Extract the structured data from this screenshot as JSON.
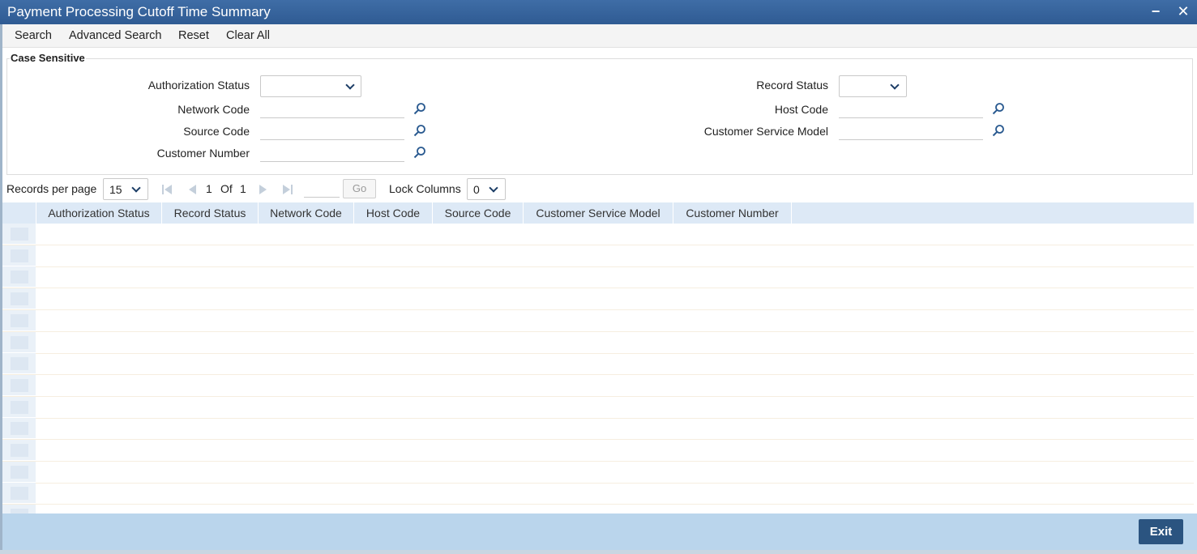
{
  "window": {
    "title": "Payment Processing Cutoff Time Summary",
    "minimize": "−",
    "close": "✕"
  },
  "toolbar": {
    "search": "Search",
    "advanced_search": "Advanced Search",
    "reset": "Reset",
    "clear_all": "Clear All"
  },
  "criteria": {
    "legend": "Case Sensitive",
    "authorization_status": {
      "label": "Authorization Status",
      "value": ""
    },
    "record_status": {
      "label": "Record Status",
      "value": ""
    },
    "network_code": {
      "label": "Network Code",
      "value": ""
    },
    "host_code": {
      "label": "Host Code",
      "value": ""
    },
    "source_code": {
      "label": "Source Code",
      "value": ""
    },
    "customer_service_model": {
      "label": "Customer Service Model",
      "value": ""
    },
    "customer_number": {
      "label": "Customer Number",
      "value": ""
    }
  },
  "pager": {
    "records_per_page_label": "Records per page",
    "records_per_page": "15",
    "current_page": "1",
    "of_label": "Of",
    "total_pages": "1",
    "go_label": "Go",
    "lock_columns_label": "Lock Columns",
    "lock_columns": "0"
  },
  "grid": {
    "columns": [
      "Authorization Status",
      "Record Status",
      "Network Code",
      "Host Code",
      "Source Code",
      "Customer Service Model",
      "Customer Number"
    ],
    "row_count": 15
  },
  "footer": {
    "exit_label": "Exit"
  },
  "colors": {
    "title_bar": "#2f5b93",
    "grid_header": "#dde9f6",
    "footer": "#bad5ec",
    "exit_button": "#2b5480"
  }
}
